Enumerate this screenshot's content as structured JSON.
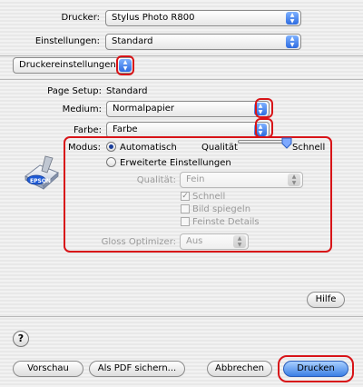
{
  "printer": {
    "label": "Drucker:",
    "value": "Stylus Photo R800"
  },
  "presets": {
    "label": "Einstellungen:",
    "value": "Standard"
  },
  "pane_menu": {
    "value": "Druckereinstellungen"
  },
  "page_setup": {
    "label": "Page Setup:",
    "value": "Standard"
  },
  "medium": {
    "label": "Medium:",
    "value": "Normalpapier"
  },
  "farbe": {
    "label": "Farbe:",
    "value": "Farbe"
  },
  "modus": {
    "label": "Modus:",
    "automatic_label": "Automatisch",
    "advanced_label": "Erweiterte Einstellungen",
    "selected": "Automatisch"
  },
  "quality_slider": {
    "left_label": "Qualität",
    "right_label": "Schnell",
    "position": 1.0
  },
  "advanced": {
    "quality_label": "Qualität:",
    "quality_value": "Fein",
    "schnell_label": "Schnell",
    "schnell_checked": true,
    "mirror_label": "Bild spiegeln",
    "mirror_checked": false,
    "fine_detail_label": "Feinste Details",
    "fine_detail_checked": false,
    "gloss_label": "Gloss Optimizer:",
    "gloss_value": "Aus"
  },
  "printer_icon": {
    "brand": "EPSON"
  },
  "buttons": {
    "help": "Hilfe",
    "help_question": "?",
    "preview": "Vorschau",
    "save_pdf": "Als PDF sichern...",
    "cancel": "Abbrechen",
    "print": "Drucken"
  },
  "colors": {
    "highlight": "#d81418",
    "accent": "#3b7fe5"
  }
}
